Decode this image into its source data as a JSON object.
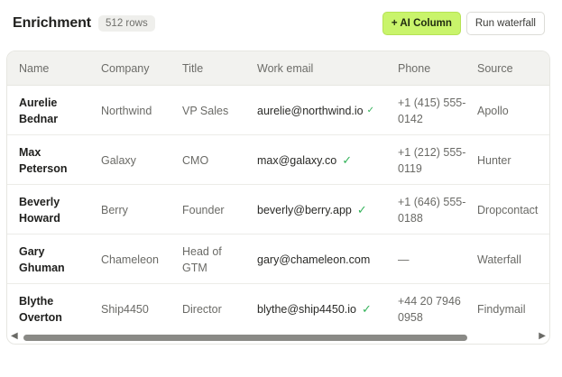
{
  "header": {
    "title": "Enrichment",
    "rows_badge": "512 rows",
    "ai_column_label": "+ AI Column",
    "run_label": "Run waterfall"
  },
  "table": {
    "columns": [
      "Name",
      "Company",
      "Title",
      "Work email",
      "Phone",
      "Source"
    ],
    "rows": [
      {
        "name": "Aurelie Bednar",
        "company": "Northwind",
        "title": "VP Sales",
        "email": "aurelie@northwind.io",
        "verified": true,
        "check": "✓",
        "phone": "+1 (415) 555-0142",
        "source": "Apollo"
      },
      {
        "name": "Max Peterson",
        "company": "Galaxy",
        "title": "CMO",
        "email": "max@galaxy.co",
        "verified": true,
        "check": "✓",
        "phone": "+1 (212) 555-0119",
        "source": "Hunter"
      },
      {
        "name": "Beverly Howard",
        "company": "Berry",
        "title": "Founder",
        "email": "beverly@berry.app",
        "verified": true,
        "check": "✓",
        "phone": "+1 (646) 555-0188",
        "source": "Dropcontact"
      },
      {
        "name": "Gary Ghuman",
        "company": "Chameleon",
        "title": "Head of GTM",
        "email": "gary@chameleon.com",
        "verified": false,
        "check": "",
        "phone": "—",
        "source": "Waterfall"
      },
      {
        "name": "Blythe Overton",
        "company": "Ship4450",
        "title": "Director",
        "email": "blythe@ship4450.io",
        "verified": true,
        "check": "✓",
        "phone": "+44 20 7946 0958",
        "source": "Findymail"
      }
    ]
  },
  "scrollbar": {
    "left_arrow": "◀",
    "right_arrow": "▶",
    "thumb_fraction": 0.87
  },
  "colors": {
    "accent": "#c9f46b",
    "verified": "#34b35a"
  }
}
